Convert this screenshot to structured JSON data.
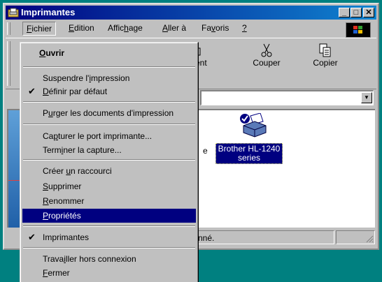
{
  "window": {
    "title": "Imprimantes"
  },
  "menubar": {
    "items": [
      {
        "pre": "",
        "key": "F",
        "post": "ichier"
      },
      {
        "pre": "",
        "key": "E",
        "post": "dition"
      },
      {
        "pre": "Affic",
        "key": "h",
        "post": "age"
      },
      {
        "pre": "",
        "key": "A",
        "post": "ller à"
      },
      {
        "pre": "Fa",
        "key": "v",
        "post": "oris"
      },
      {
        "pre": "",
        "key": "?",
        "post": ""
      }
    ]
  },
  "toolbar": {
    "up_label": "r parent",
    "cut_label": "Couper",
    "copy_label": "Copier"
  },
  "content": {
    "printer_label": "Brother HL-1240 series",
    "partial_text": "e"
  },
  "statusbar": {
    "text": "nné."
  },
  "menu": {
    "open": {
      "pre": "",
      "key": "O",
      "post": "uvrir"
    },
    "pause": {
      "pre": "Suspendre l'",
      "key": "i",
      "post": "mpression"
    },
    "default": {
      "pre": "",
      "key": "D",
      "post": "éfinir par défaut"
    },
    "purge": {
      "pre": "P",
      "key": "u",
      "post": "rger les documents d'impression"
    },
    "capture": {
      "pre": "Ca",
      "key": "p",
      "post": "turer le port imprimante..."
    },
    "end_capture": {
      "pre": "Term",
      "key": "i",
      "post": "ner la capture..."
    },
    "shortcut": {
      "pre": "Créer ",
      "key": "u",
      "post": "n raccourci"
    },
    "delete": {
      "pre": "",
      "key": "S",
      "post": "upprimer"
    },
    "rename": {
      "pre": "",
      "key": "R",
      "post": "enommer"
    },
    "properties": {
      "pre": "",
      "key": "P",
      "post": "ropriétés"
    },
    "printers": {
      "pre": "Imprimantes",
      "key": "",
      "post": ""
    },
    "offline": {
      "pre": "Trava",
      "key": "i",
      "post": "ller hors connexion"
    },
    "close": {
      "pre": "",
      "key": "F",
      "post": "ermer"
    }
  }
}
